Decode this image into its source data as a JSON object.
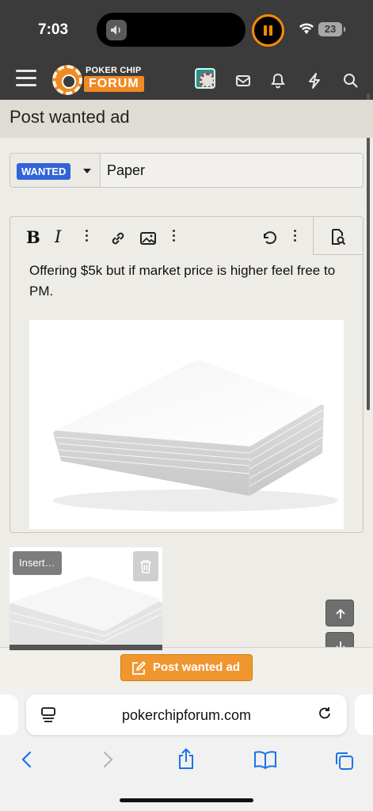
{
  "status": {
    "time": "7:03",
    "battery": "23"
  },
  "header": {
    "logo_top": "POKER CHIP",
    "logo_bottom": "FORUM"
  },
  "page": {
    "title": "Post wanted ad"
  },
  "form": {
    "prefix": "WANTED",
    "title_value": "Paper",
    "body_text": "Offering $5k but if market price is higher feel free to PM.",
    "attachment_insert_label": "Insert…",
    "submit_label": "Post wanted ad"
  },
  "toolbar": {
    "bold": "B",
    "italic": "I"
  },
  "browser": {
    "url": "pokerchipforum.com"
  },
  "colors": {
    "accent": "#f0962f",
    "prefix": "#3264d8",
    "header": "#3b3b3b",
    "link_blue": "#1a73e8"
  }
}
